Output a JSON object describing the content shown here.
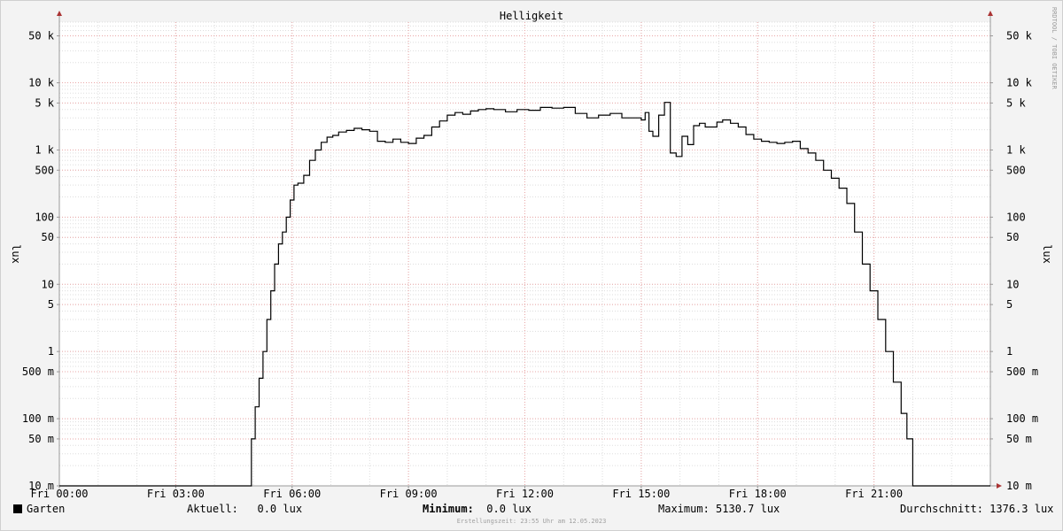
{
  "chart_data": {
    "type": "line",
    "title": "Helligkeit",
    "ylabel": "lux",
    "yscale": "log",
    "ylim": [
      0.01,
      80000
    ],
    "xlim": [
      0,
      24
    ],
    "grid": true,
    "x_ticks": [
      {
        "x": 0,
        "label": "Fri 00:00"
      },
      {
        "x": 3,
        "label": "Fri 03:00"
      },
      {
        "x": 6,
        "label": "Fri 06:00"
      },
      {
        "x": 9,
        "label": "Fri 09:00"
      },
      {
        "x": 12,
        "label": "Fri 12:00"
      },
      {
        "x": 15,
        "label": "Fri 15:00"
      },
      {
        "x": 18,
        "label": "Fri 18:00"
      },
      {
        "x": 21,
        "label": "Fri 21:00"
      }
    ],
    "y_ticks": [
      {
        "y": 0.01,
        "label": "10 m"
      },
      {
        "y": 0.05,
        "label": "50 m"
      },
      {
        "y": 0.1,
        "label": "100 m"
      },
      {
        "y": 0.5,
        "label": "500 m"
      },
      {
        "y": 1,
        "label": "1"
      },
      {
        "y": 5,
        "label": "5"
      },
      {
        "y": 10,
        "label": "10"
      },
      {
        "y": 50,
        "label": "50"
      },
      {
        "y": 100,
        "label": "100"
      },
      {
        "y": 500,
        "label": "500"
      },
      {
        "y": 1000,
        "label": "1 k"
      },
      {
        "y": 5000,
        "label": "5 k"
      },
      {
        "y": 10000,
        "label": "10 k"
      },
      {
        "y": 50000,
        "label": "50 k"
      }
    ],
    "series": [
      {
        "name": "Garten",
        "color": "#000000",
        "x": [
          0,
          4.9,
          4.95,
          5.05,
          5.15,
          5.25,
          5.35,
          5.45,
          5.55,
          5.65,
          5.75,
          5.85,
          5.95,
          6.05,
          6.15,
          6.3,
          6.45,
          6.6,
          6.75,
          6.9,
          7.05,
          7.2,
          7.4,
          7.6,
          7.8,
          8.0,
          8.2,
          8.4,
          8.6,
          8.8,
          9.0,
          9.2,
          9.4,
          9.6,
          9.8,
          10.0,
          10.2,
          10.4,
          10.6,
          10.8,
          11.0,
          11.2,
          11.5,
          11.8,
          12.1,
          12.4,
          12.7,
          13.0,
          13.3,
          13.6,
          13.9,
          14.2,
          14.5,
          14.8,
          15.0,
          15.1,
          15.2,
          15.3,
          15.45,
          15.6,
          15.75,
          15.9,
          16.05,
          16.2,
          16.35,
          16.5,
          16.65,
          16.8,
          16.95,
          17.1,
          17.3,
          17.5,
          17.7,
          17.9,
          18.1,
          18.3,
          18.5,
          18.7,
          18.9,
          19.1,
          19.3,
          19.5,
          19.7,
          19.9,
          20.1,
          20.3,
          20.5,
          20.7,
          20.9,
          21.1,
          21.3,
          21.5,
          21.7,
          21.85,
          22.0,
          22.15,
          22.3,
          22.4,
          22.5,
          22.6,
          22.7,
          22.8,
          22.9,
          24
        ],
        "y": [
          0.01,
          0.01,
          0.05,
          0.15,
          0.4,
          1.0,
          3.0,
          8.0,
          20,
          40,
          60,
          100,
          180,
          300,
          320,
          420,
          700,
          1000,
          1300,
          1550,
          1650,
          1850,
          1950,
          2100,
          2000,
          1900,
          1350,
          1300,
          1450,
          1300,
          1250,
          1500,
          1650,
          2200,
          2700,
          3300,
          3600,
          3400,
          3800,
          4000,
          4100,
          4000,
          3700,
          4000,
          3900,
          4300,
          4200,
          4300,
          3500,
          3000,
          3300,
          3500,
          3000,
          3000,
          2800,
          3600,
          1900,
          1600,
          3300,
          5100,
          900,
          800,
          1600,
          1200,
          2300,
          2500,
          2200,
          2200,
          2600,
          2800,
          2500,
          2200,
          1700,
          1450,
          1350,
          1300,
          1250,
          1300,
          1350,
          1050,
          900,
          700,
          500,
          380,
          270,
          160,
          60,
          20,
          8,
          3,
          1.0,
          0.35,
          0.12,
          0.05,
          0.01,
          0.01,
          0.01,
          0.01,
          0.01,
          0.01,
          0.01,
          0.01,
          0.01,
          0.01
        ]
      }
    ]
  },
  "side_text": "RRDTOOL / TOBI OETIKER",
  "legend": {
    "series_name": "Garten",
    "current_label": "Aktuell:",
    "current_value": "0.0 lux",
    "min_label": "Minimum:",
    "min_value": "0.0 lux",
    "max_label": "Maximum:",
    "max_value": "5130.7 lux",
    "avg_label": "Durchschnitt:",
    "avg_value": "1376.3 lux"
  },
  "footer": "Erstellungszeit: 23:55 Uhr am 12.05.2023"
}
